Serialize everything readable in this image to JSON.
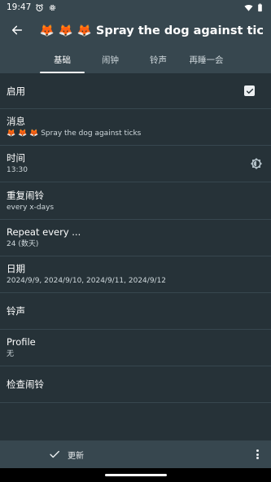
{
  "status_bar": {
    "time": "19:47",
    "left_icons": [
      "alarm-icon",
      "settings-icon"
    ],
    "right_icons": [
      "wifi-icon",
      "battery-icon"
    ]
  },
  "app_bar": {
    "back_icon": "arrow-left-icon",
    "title": "🦊 🦊 🦊 Spray the dog against ticks"
  },
  "tabs": [
    {
      "label": "基础",
      "active": true
    },
    {
      "label": "闹钟",
      "active": false
    },
    {
      "label": "铃声",
      "active": false
    },
    {
      "label": "再睡一会",
      "active": false
    }
  ],
  "rows": {
    "enabled": {
      "label": "启用",
      "checked": true
    },
    "message": {
      "label": "消息",
      "value": "🦊 🦊 🦊 Spray the dog against ticks"
    },
    "time": {
      "label": "时间",
      "value": "13:30",
      "icon": "brightness-icon"
    },
    "repeat_alarm": {
      "label": "重复闹铃",
      "value": "every x-days"
    },
    "repeat_every": {
      "label": "Repeat every ...",
      "value": "24 (数天)"
    },
    "date": {
      "label": "日期",
      "value": "2024/9/9, 2024/9/10, 2024/9/11, 2024/9/12"
    },
    "ringtone": {
      "label": "铃声"
    },
    "profile": {
      "label": "Profile",
      "value": "无"
    },
    "check_alarm": {
      "label": "检查闹铃"
    }
  },
  "bottom_bar": {
    "update_label": "更新",
    "update_icon": "check-icon",
    "more_icon": "more-vert-icon"
  }
}
